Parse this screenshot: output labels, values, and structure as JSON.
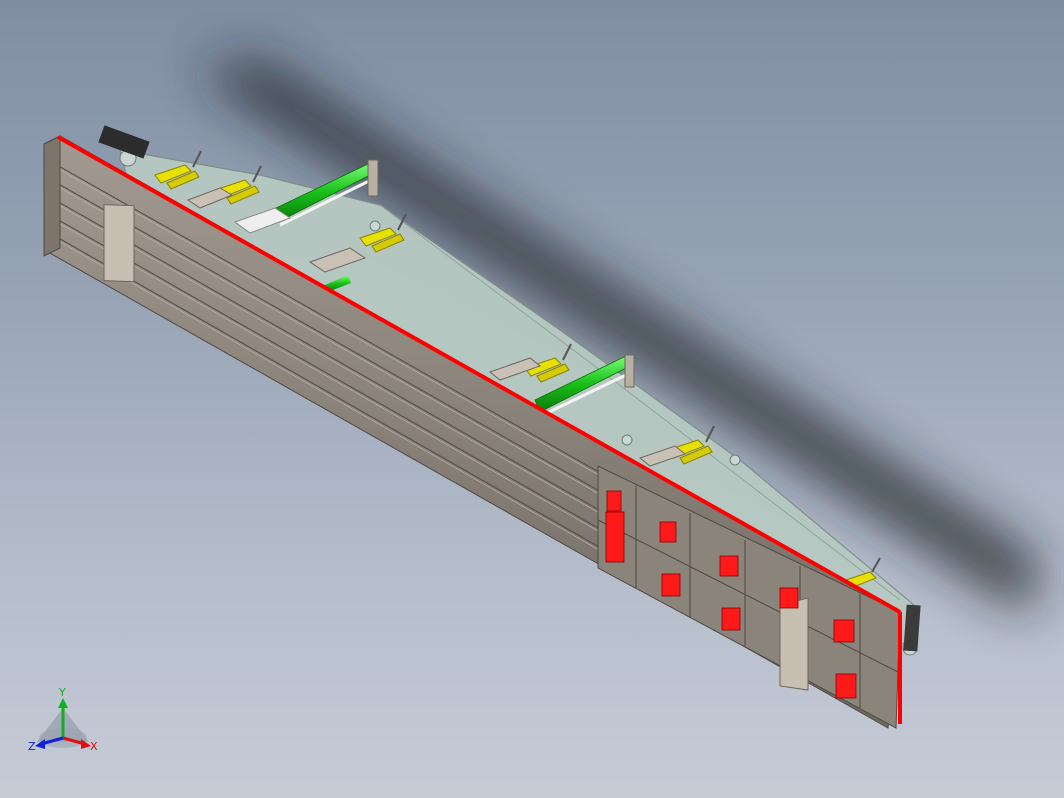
{
  "viewport": {
    "background_top": "#7f8ea3",
    "background_bottom": "#c6cbd6"
  },
  "model": {
    "colors": {
      "frame": "#8f877e",
      "frame_dark": "#5f5852",
      "frame_light": "#b3aca4",
      "edge_highlight": "#ff0000",
      "boom": "#b7c9c2",
      "cylinder": "#22c422",
      "clamp": "#e8e000",
      "plate": "#ff1a1a",
      "shadow": "#1f2326"
    }
  },
  "triad": {
    "x_label": "X",
    "y_label": "Y",
    "z_label": "Z",
    "x_color": "#e01010",
    "y_color": "#10b020",
    "z_color": "#1020e0"
  }
}
